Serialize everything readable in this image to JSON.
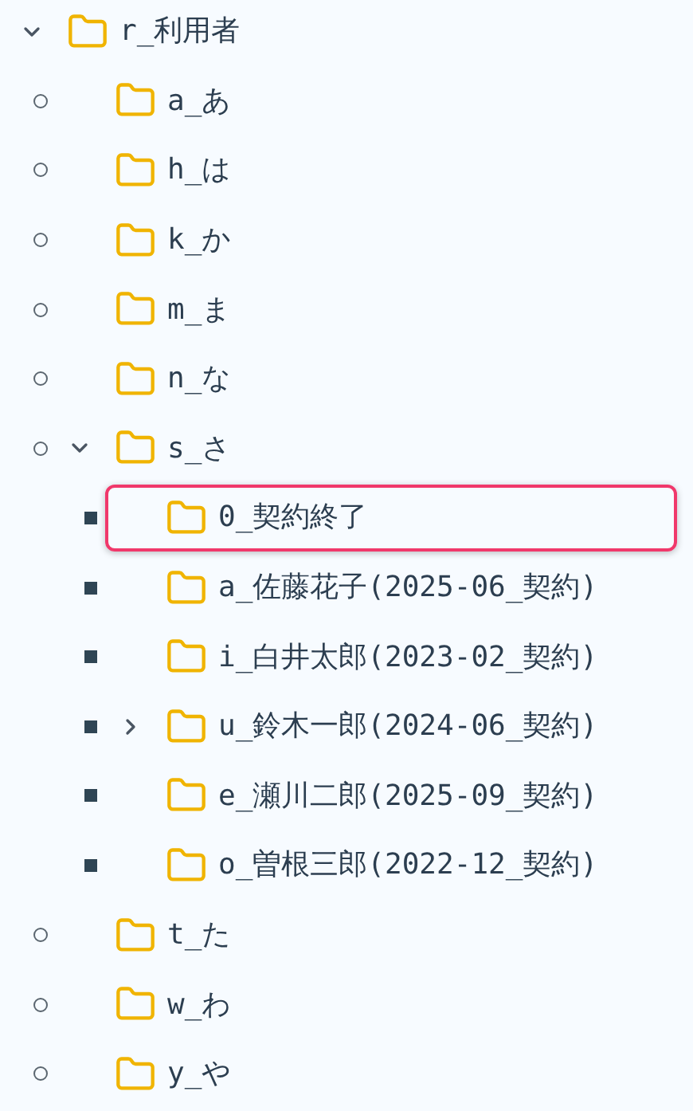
{
  "tree": [
    {
      "label": "r_利用者",
      "expandable": true,
      "expanded": true,
      "selected": false,
      "children": [
        {
          "label": "a_あ",
          "expandable": false,
          "expanded": false,
          "selected": false
        },
        {
          "label": "h_は",
          "expandable": false,
          "expanded": false,
          "selected": false
        },
        {
          "label": "k_か",
          "expandable": false,
          "expanded": false,
          "selected": false
        },
        {
          "label": "m_ま",
          "expandable": false,
          "expanded": false,
          "selected": false
        },
        {
          "label": "n_な",
          "expandable": false,
          "expanded": false,
          "selected": false
        },
        {
          "label": "s_さ",
          "expandable": true,
          "expanded": true,
          "selected": false,
          "children": [
            {
              "label": "0_契約終了",
              "expandable": false,
              "expanded": false,
              "selected": true
            },
            {
              "label": "a_佐藤花子(2025-06_契約)",
              "expandable": false,
              "expanded": false,
              "selected": false
            },
            {
              "label": "i_白井太郎(2023-02_契約)",
              "expandable": false,
              "expanded": false,
              "selected": false
            },
            {
              "label": "u_鈴木一郎(2024-06_契約)",
              "expandable": true,
              "expanded": false,
              "selected": false
            },
            {
              "label": "e_瀬川二郎(2025-09_契約)",
              "expandable": false,
              "expanded": false,
              "selected": false
            },
            {
              "label": "o_曽根三郎(2022-12_契約)",
              "expandable": false,
              "expanded": false,
              "selected": false
            }
          ]
        },
        {
          "label": "t_た",
          "expandable": false,
          "expanded": false,
          "selected": false
        },
        {
          "label": "w_わ",
          "expandable": false,
          "expanded": false,
          "selected": false
        },
        {
          "label": "y_や",
          "expandable": false,
          "expanded": false,
          "selected": false
        }
      ]
    }
  ]
}
